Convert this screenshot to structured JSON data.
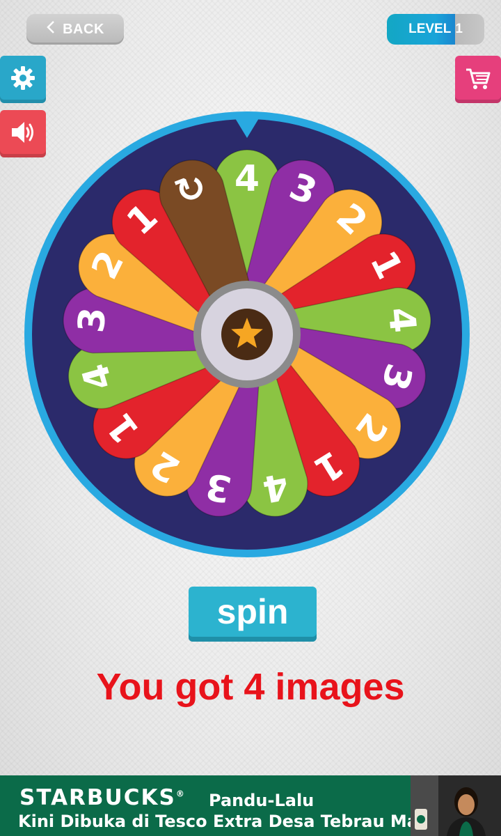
{
  "header": {
    "back_label": "BACK",
    "level_label": "LEVEL",
    "level_number": "1"
  },
  "toolbar": {
    "settings_icon": "gear-icon",
    "sound_icon": "speaker-icon",
    "cart_icon": "shopping-cart-icon"
  },
  "wheel": {
    "center_icon": "star-icon",
    "pointer_icon": "triangle-pointer-icon",
    "segments": [
      {
        "label": "4",
        "color": "#8bc443"
      },
      {
        "label": "3",
        "color": "#8f2ea5"
      },
      {
        "label": "2",
        "color": "#fbb03b"
      },
      {
        "label": "1",
        "color": "#e3232c"
      },
      {
        "label": "4",
        "color": "#8bc443"
      },
      {
        "label": "3",
        "color": "#8f2ea5"
      },
      {
        "label": "2",
        "color": "#fbb03b"
      },
      {
        "label": "1",
        "color": "#e3232c"
      },
      {
        "label": "4",
        "color": "#8bc443"
      },
      {
        "label": "3",
        "color": "#8f2ea5"
      },
      {
        "label": "2",
        "color": "#fbb03b"
      },
      {
        "label": "1",
        "color": "#e3232c"
      },
      {
        "label": "4",
        "color": "#8bc443"
      },
      {
        "label": "3",
        "color": "#8f2ea5"
      },
      {
        "label": "2",
        "color": "#fbb03b"
      },
      {
        "label": "1",
        "color": "#e3232c"
      },
      {
        "label": "↻",
        "color": "#7a4a24"
      }
    ]
  },
  "actions": {
    "spin_label": "spin"
  },
  "result": {
    "text": "You got 4 images"
  },
  "ad": {
    "brand": "STARBUCKS",
    "trademark": "®",
    "location": "Pandu-Lalu",
    "tagline": "Kini Dibuka di Tesco Extra Desa Tebrau Mall",
    "background": "#0b6b49"
  },
  "colors": {
    "accent": "#2cb3cf",
    "result_red": "#e8131b",
    "wheel_ring": "#29a9e1",
    "wheel_inner": "#2b2a6b"
  }
}
